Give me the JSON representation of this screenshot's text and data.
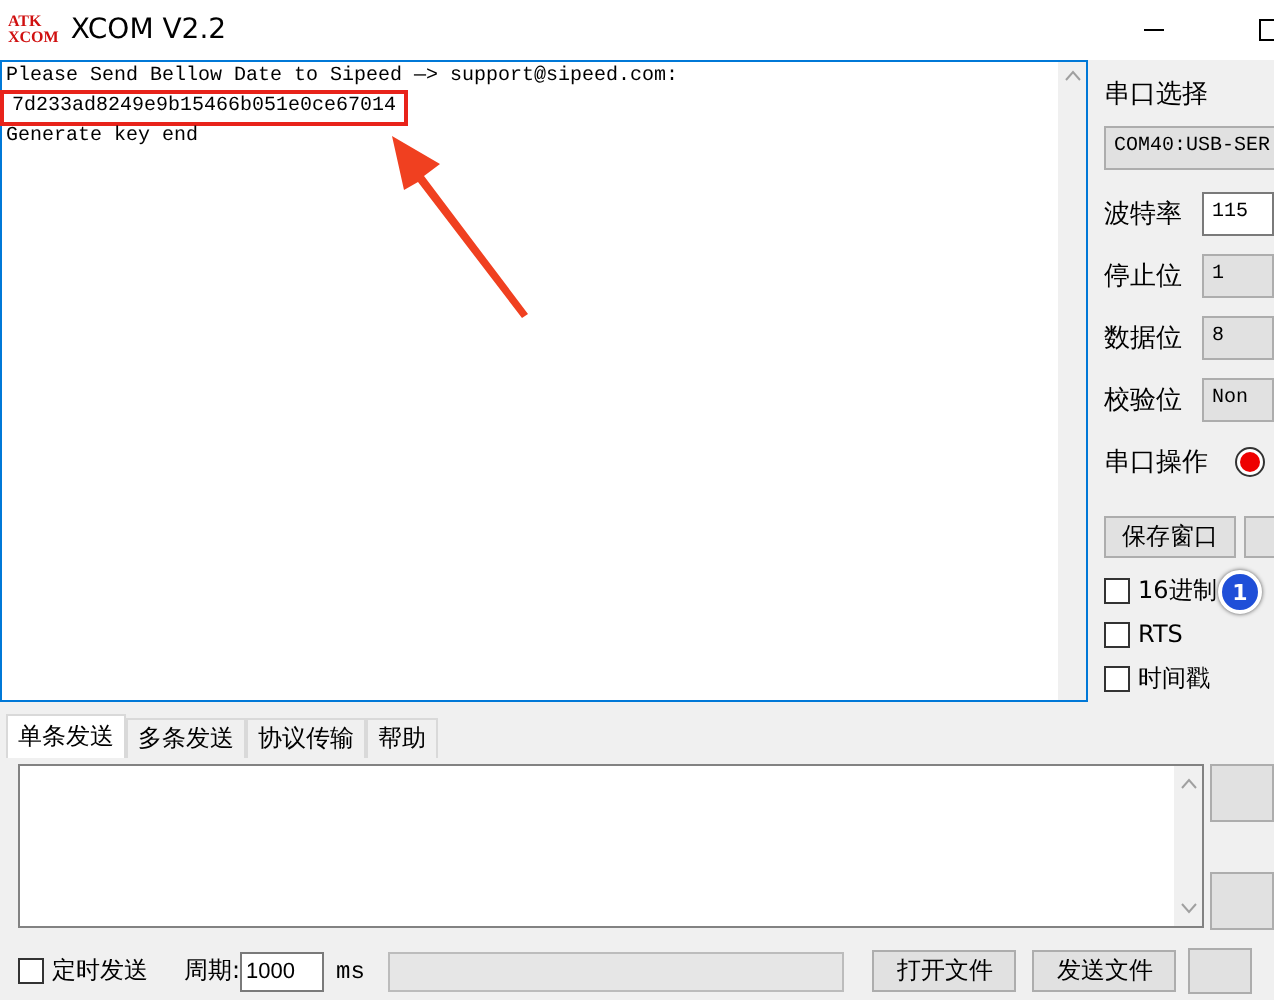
{
  "window": {
    "title": "XCOM V2.2",
    "logo_lines": [
      "ATK",
      "XCOM"
    ]
  },
  "receive_log": {
    "lines": [
      {
        "text": "Please Send Bellow Date to Sipeed —> support@sipeed.com:",
        "highlighted": false
      },
      {
        "text": "7d233ad8249e9b15466b051e0ce67014",
        "highlighted": true
      },
      {
        "text": "Generate key end",
        "highlighted": false
      }
    ]
  },
  "serial_panel": {
    "port_label": "串口选择",
    "port_value": "COM40:USB-SER",
    "settings": [
      {
        "label": "波特率",
        "value": "115",
        "kind": "input"
      },
      {
        "label": "停止位",
        "value": "1",
        "kind": "select"
      },
      {
        "label": "数据位",
        "value": "8",
        "kind": "select"
      },
      {
        "label": "校验位",
        "value": "Non",
        "kind": "select"
      }
    ],
    "operation": {
      "label": "串口操作",
      "open": false
    },
    "save_button": "保存窗口",
    "options": [
      {
        "label": "16进制",
        "checked": false
      },
      {
        "label": "RTS",
        "checked": false
      },
      {
        "label": "时间戳",
        "checked": false
      }
    ]
  },
  "send_tabs": [
    {
      "label": "单条发送",
      "selected": true
    },
    {
      "label": "多条发送",
      "selected": false
    },
    {
      "label": "协议传输",
      "selected": false
    },
    {
      "label": "帮助",
      "selected": false
    }
  ],
  "send_bar": {
    "timed_send": {
      "label": "定时发送",
      "checked": false
    },
    "period_label": "周期:",
    "period_value": "1000",
    "unit": "ms",
    "open_file": "打开文件",
    "send_file": "发送文件"
  },
  "annotation": {
    "badge": "1"
  }
}
